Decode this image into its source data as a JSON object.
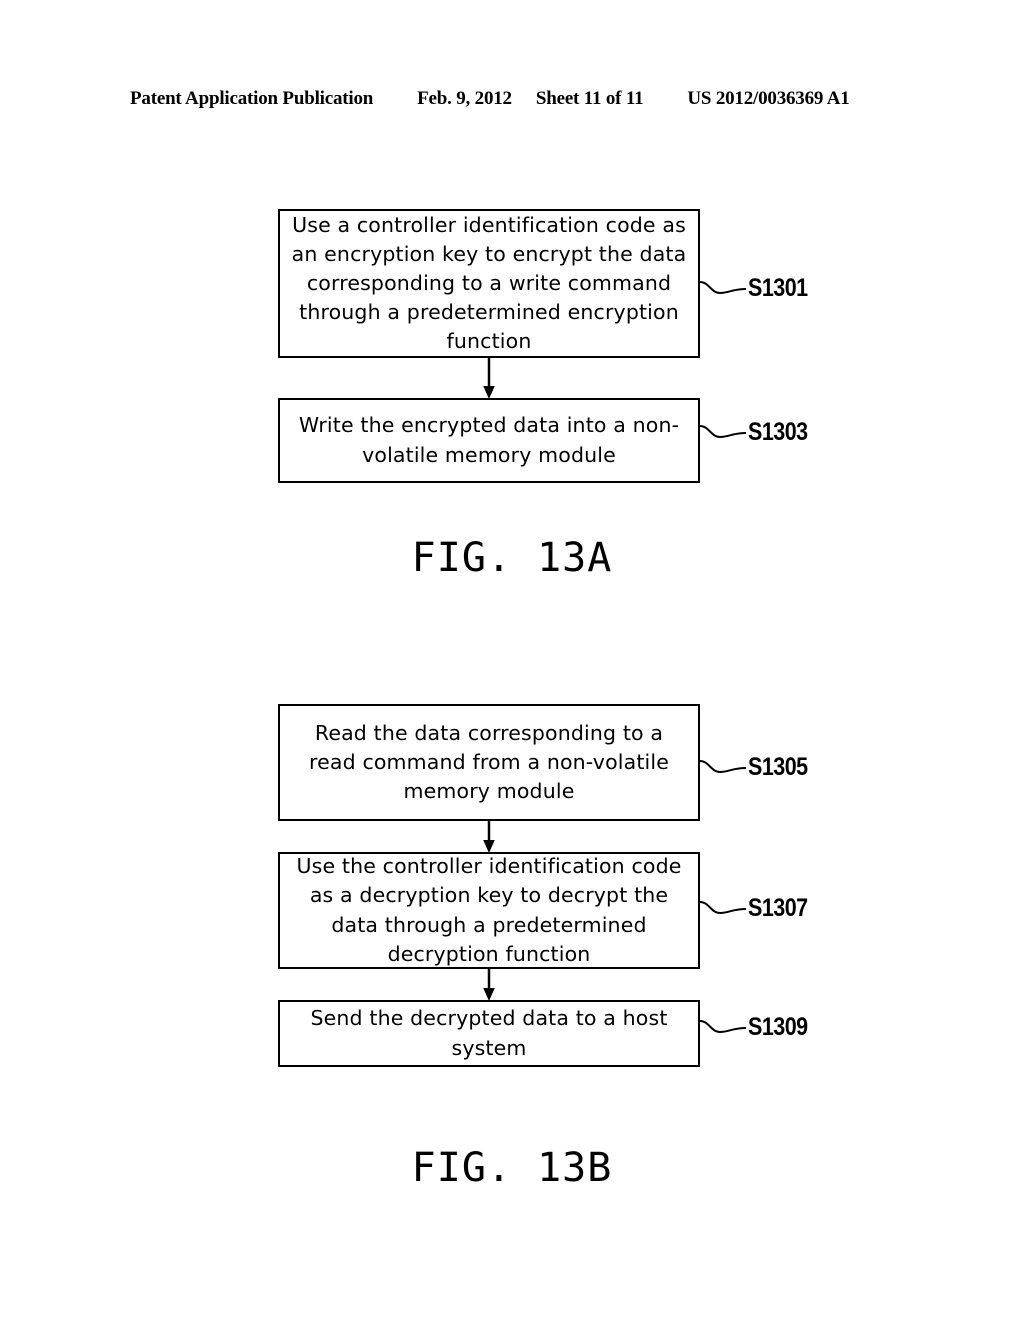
{
  "header": {
    "publication": "Patent Application Publication",
    "date": "Feb. 9, 2012",
    "sheet": "Sheet 11 of 11",
    "document_number": "US 2012/0036369 A1"
  },
  "figures": [
    {
      "caption": "FIG. 13A",
      "steps": [
        {
          "ref": "S1301",
          "text": "Use a controller identification code as an encryption key to encrypt the data corresponding to a write command through a predetermined encryption function"
        },
        {
          "ref": "S1303",
          "text": "Write the encrypted data into a non-volatile memory module"
        }
      ]
    },
    {
      "caption": "FIG. 13B",
      "steps": [
        {
          "ref": "S1305",
          "text": "Read the data corresponding to a read command from a non-volatile memory module"
        },
        {
          "ref": "S1307",
          "text": "Use the controller identification code as a decryption key to decrypt the data through a predetermined decryption function"
        },
        {
          "ref": "S1309",
          "text": "Send the decrypted data to a host system"
        }
      ]
    }
  ],
  "colors": {
    "ink": "#000000",
    "paper": "#ffffff"
  }
}
